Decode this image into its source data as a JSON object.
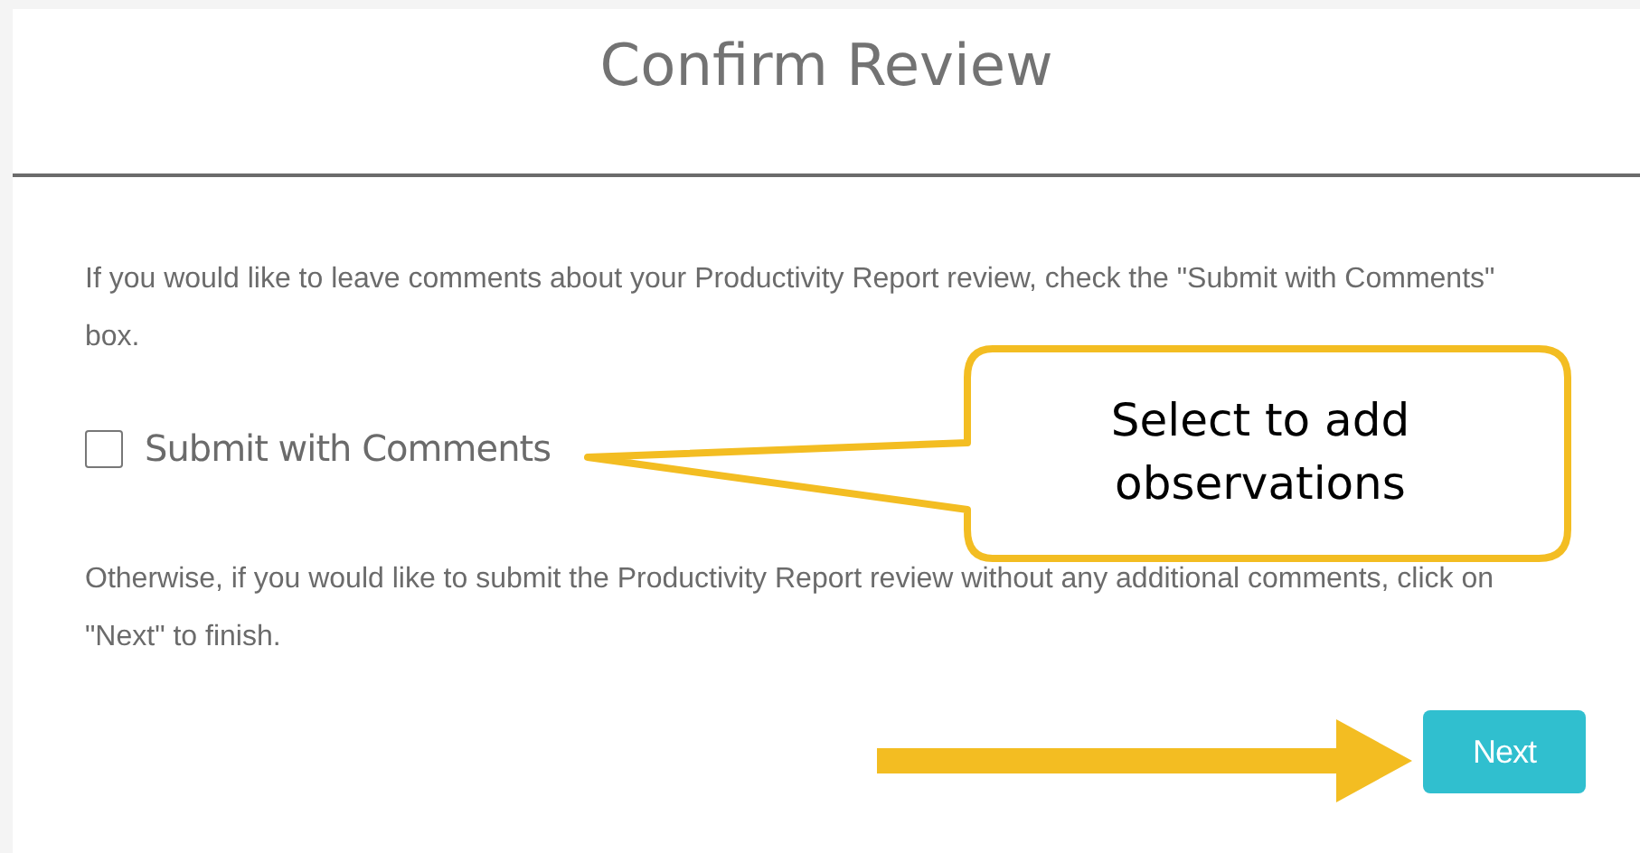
{
  "dialog": {
    "title": "Confirm Review"
  },
  "intro_text": "If you would like to leave comments about your Productivity Report review, check the \"Submit with Comments\" box.",
  "checkbox": {
    "label": "Submit with Comments",
    "checked": false
  },
  "callout": {
    "text": "Select to add observations"
  },
  "body_text": "Otherwise, if you would like to submit the Productivity Report review without any additional comments, click on \"Next\" to finish.",
  "next_button": {
    "label": "Next"
  }
}
